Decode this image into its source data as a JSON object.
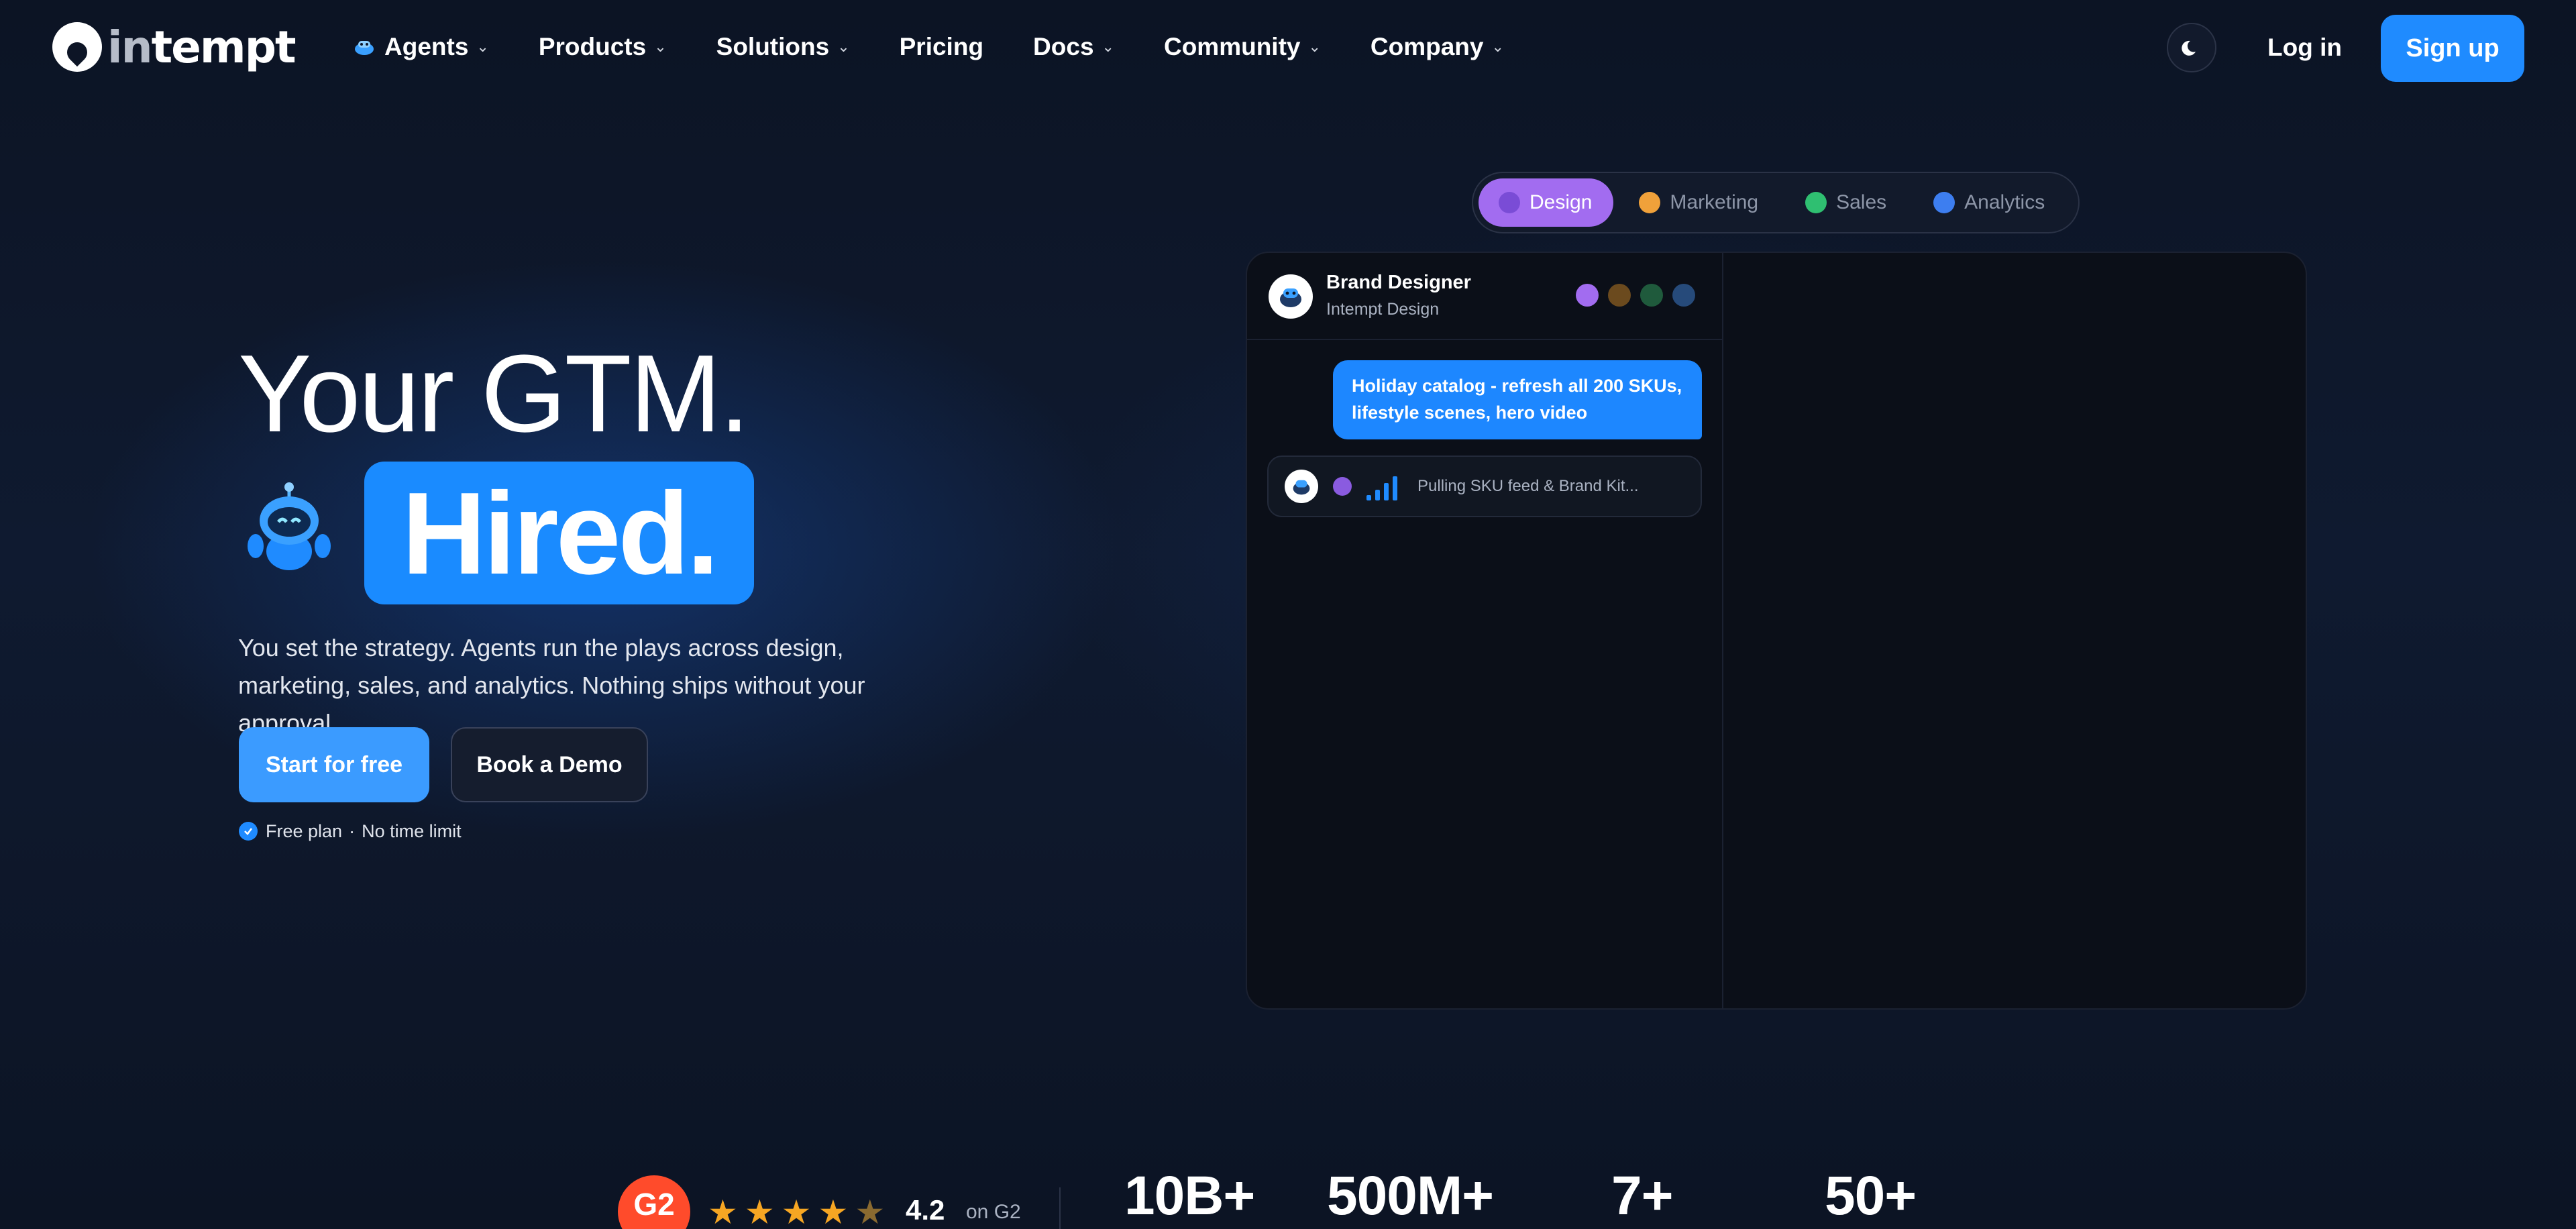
{
  "nav": {
    "logo_text_in": "in",
    "logo_text_rest": "tempt",
    "items": [
      {
        "label": "Agents",
        "has_dropdown": true,
        "icon": "agent-robot-icon"
      },
      {
        "label": "Products",
        "has_dropdown": true
      },
      {
        "label": "Solutions",
        "has_dropdown": true
      },
      {
        "label": "Pricing",
        "has_dropdown": false
      },
      {
        "label": "Docs",
        "has_dropdown": true
      },
      {
        "label": "Community",
        "has_dropdown": true
      },
      {
        "label": "Company",
        "has_dropdown": true
      }
    ],
    "theme_icon": "moon-icon",
    "login_label": "Log in",
    "signup_label": "Sign up"
  },
  "hero": {
    "title_line1": "Your GTM.",
    "title_line2": "Hired.",
    "subtitle": "You set the strategy. Agents run the plays across design, marketing, sales, and analytics. Nothing ships without your approval.",
    "primary_cta": "Start for free",
    "secondary_cta": "Book a Demo",
    "note_plan": "Free plan",
    "note_separator": "·",
    "note_limit": "No time limit"
  },
  "tabs": {
    "active": "Design",
    "items": [
      {
        "label": "Design",
        "color": "#a26cf0"
      },
      {
        "label": "Marketing",
        "color": "#f0a13a"
      },
      {
        "label": "Sales",
        "color": "#2fbf71"
      },
      {
        "label": "Analytics",
        "color": "#3d7ef0"
      }
    ]
  },
  "chat": {
    "agent_name": "Brand Designer",
    "agent_org": "Intempt Design",
    "header_icon_colors": [
      "#a26cf0",
      "#6b4a1e",
      "#1f5a3c",
      "#264a7a"
    ],
    "user_message": "Holiday catalog - refresh all 200 SKUs, lifestyle scenes, hero video",
    "status_text": "Pulling SKU feed & Brand Kit..."
  },
  "stats": {
    "g2_badge": "G2",
    "rating_stars": 4.2,
    "rating": "4.2",
    "rating_source": "on G2",
    "values": [
      "10B+",
      "500M+",
      "7+",
      "50+"
    ]
  },
  "colors": {
    "accent": "#1f8bff",
    "background": "#0d1526",
    "design_purple": "#a26cf0"
  }
}
